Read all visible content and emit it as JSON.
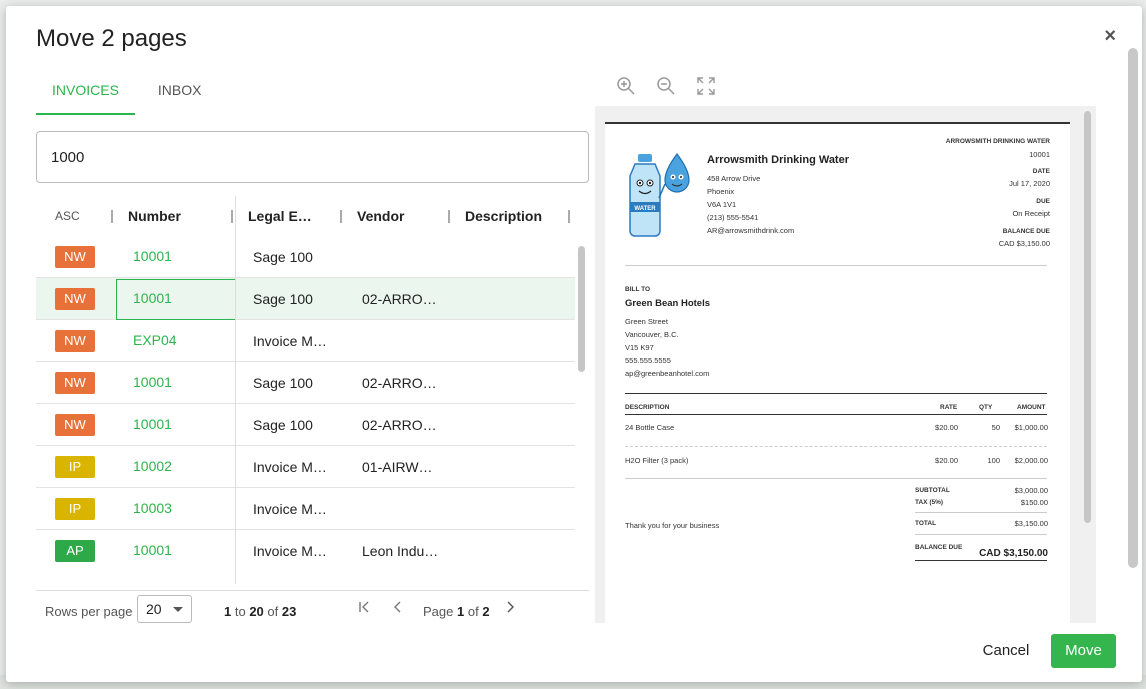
{
  "dialog": {
    "title": "Move 2 pages",
    "close_label": "×",
    "tabs": [
      {
        "label": "INVOICES",
        "active": true
      },
      {
        "label": "INBOX",
        "active": false
      }
    ],
    "search": {
      "value": "1000",
      "placeholder": ""
    },
    "grid": {
      "columns": [
        "ASC",
        "Number",
        "Legal E…",
        "Vendor",
        "Description"
      ],
      "rows": [
        {
          "status": "NW",
          "number": "10001",
          "legal": "Sage 100",
          "vendor": ""
        },
        {
          "status": "NW",
          "number": "10001",
          "legal": "Sage 100",
          "vendor": "02-ARRO…"
        },
        {
          "status": "NW",
          "number": "EXP04",
          "legal": "Invoice M…",
          "vendor": ""
        },
        {
          "status": "NW",
          "number": "10001",
          "legal": "Sage 100",
          "vendor": "02-ARRO…"
        },
        {
          "status": "NW",
          "number": "10001",
          "legal": "Sage 100",
          "vendor": "02-ARRO…"
        },
        {
          "status": "IP",
          "number": "10002",
          "legal": "Invoice M…",
          "vendor": "01-AIRW…"
        },
        {
          "status": "IP",
          "number": "10003",
          "legal": "Invoice M…",
          "vendor": ""
        },
        {
          "status": "AP",
          "number": "10001",
          "legal": "Invoice M…",
          "vendor": "Leon Indu…"
        }
      ],
      "status_colors": {
        "NW": "#e8713a",
        "IP": "#d9b400",
        "AP": "#2ea94a"
      },
      "footer": {
        "rows_per_page_label": "Rows per page",
        "rows_per_page_value": "20",
        "range_start": "1",
        "range_to": "to",
        "range_end": "20",
        "range_of": "of",
        "range_total": "23",
        "page_label": "Page",
        "page_current": "1",
        "page_of": "of",
        "page_total": "2"
      }
    },
    "invoice": {
      "seller_name_caps": "ARROWSMITH DRINKING WATER",
      "invoice_number": "10001",
      "company": "Arrowsmith Drinking Water",
      "address": [
        "458 Arrow Drive",
        "Phoenix",
        "V6A 1V1",
        "(213) 555-5541",
        "AR@arrowsmithdrink.com"
      ],
      "date_label": "DATE",
      "date": "Jul 17, 2020",
      "due_label": "DUE",
      "due": "On Receipt",
      "balance_due_label": "BALANCE DUE",
      "balance_due": "CAD $3,150.00",
      "bill_to_label": "BILL TO",
      "bill_to_name": "Green Bean Hotels",
      "bill_to_address": [
        "Green Street",
        "Vancouver, B.C.",
        "V15 K97",
        "555.555.5555",
        "ap@greenbeanhotel.com"
      ],
      "table_headers": {
        "description": "DESCRIPTION",
        "rate": "RATE",
        "qty": "QTY",
        "amount": "AMOUNT"
      },
      "items": [
        {
          "description": "24 Bottle Case",
          "rate": "$20.00",
          "qty": "50",
          "amount": "$1,000.00"
        },
        {
          "description": "H2O Filter (3 pack)",
          "rate": "$20.00",
          "qty": "100",
          "amount": "$2,000.00"
        }
      ],
      "thanks": "Thank you for your business",
      "subtotal_label": "SUBTOTAL",
      "subtotal": "$3,000.00",
      "tax_label": "TAX (5%)",
      "tax": "$150.00",
      "total_label": "TOTAL",
      "total": "$3,150.00",
      "final_balance_label": "BALANCE DUE",
      "final_balance": "CAD $3,150.00",
      "logo_text": "WATER"
    },
    "actions": {
      "cancel": "Cancel",
      "move": "Move"
    }
  },
  "icons": [
    "zoom-in-icon",
    "zoom-out-icon",
    "fullscreen-icon",
    "close-icon",
    "first-page-icon",
    "prev-page-icon",
    "next-page-icon",
    "chevron-down-icon"
  ],
  "accent_color": "#2cb44d"
}
